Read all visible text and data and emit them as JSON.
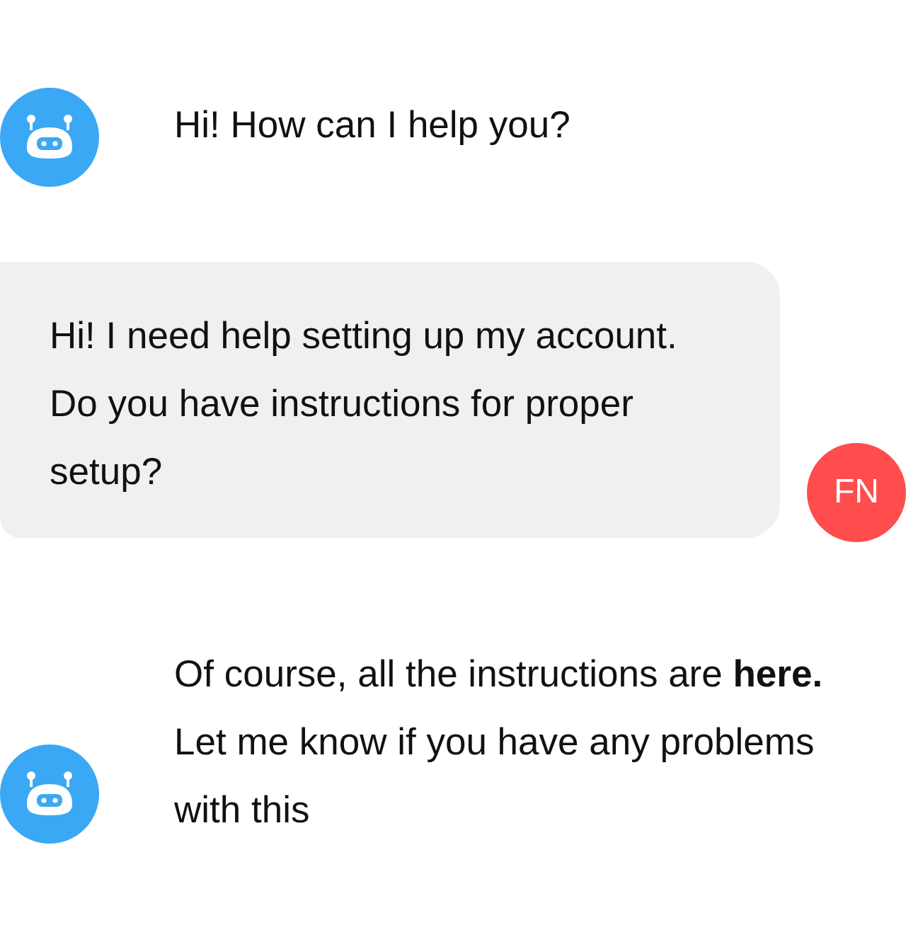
{
  "messages": [
    {
      "kind": "bot",
      "text": "Hi! How can I help you?"
    },
    {
      "kind": "user",
      "text": "Hi! I need help setting up my account. Do you have instructions for proper setup?",
      "avatar": "FN"
    },
    {
      "kind": "bot",
      "text": "Of course, all the instructions are **here.** Let me know if you have any problems with this"
    }
  ]
}
